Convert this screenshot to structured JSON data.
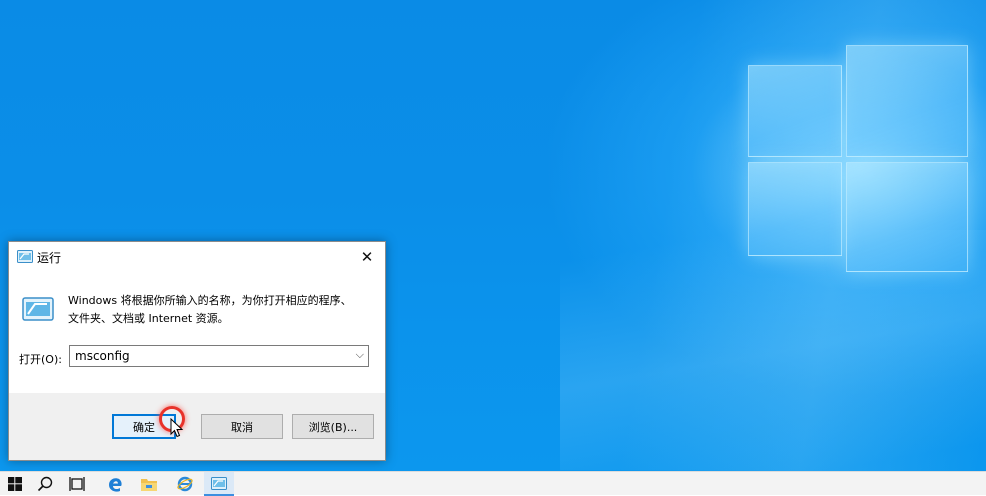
{
  "dialog": {
    "title": "运行",
    "description_line1": "Windows 将根据你所输入的名称，为你打开相应的程序、",
    "description_line2": "文件夹、文档或 Internet 资源。",
    "open_label": "打开(O):",
    "input_value": "msconfig",
    "ok_label": "确定",
    "cancel_label": "取消",
    "browse_label": "浏览(B)..."
  },
  "taskbar": {
    "icons": [
      "windows-start-icon",
      "search-icon",
      "task-view-icon",
      "edge-icon",
      "file-explorer-icon",
      "internet-explorer-icon",
      "run-icon"
    ]
  },
  "colors": {
    "desktop_blue": "#0b8ee8",
    "accent": "#0078d7",
    "click_highlight": "#e8322a"
  }
}
